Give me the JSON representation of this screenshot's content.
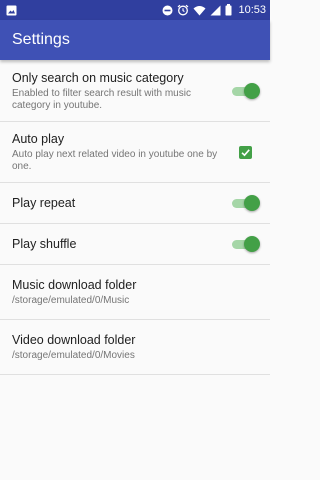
{
  "statusbar": {
    "time": "10:53",
    "icons": [
      "image-icon",
      "do-not-disturb-icon",
      "alarm-icon",
      "wifi-icon",
      "signal-icon",
      "battery-icon"
    ]
  },
  "appbar": {
    "title": "Settings"
  },
  "colors": {
    "primary": "#3f51b5",
    "primary_dark": "#303f9f",
    "accent": "#43a047"
  },
  "settings": [
    {
      "title": "Only search on music category",
      "summary": "Enabled to filter search result with music category in youtube.",
      "control": "switch",
      "checked": true
    },
    {
      "title": "Auto play",
      "summary": "Auto play next related video in youtube one by one.",
      "control": "checkbox",
      "checked": true
    },
    {
      "title": "Play repeat",
      "summary": "",
      "control": "switch",
      "checked": true
    },
    {
      "title": "Play shuffle",
      "summary": "",
      "control": "switch",
      "checked": true
    },
    {
      "title": "Music download folder",
      "summary": "/storage/emulated/0/Music",
      "control": "none"
    },
    {
      "title": "Video download folder",
      "summary": "/storage/emulated/0/Movies",
      "control": "none"
    }
  ]
}
